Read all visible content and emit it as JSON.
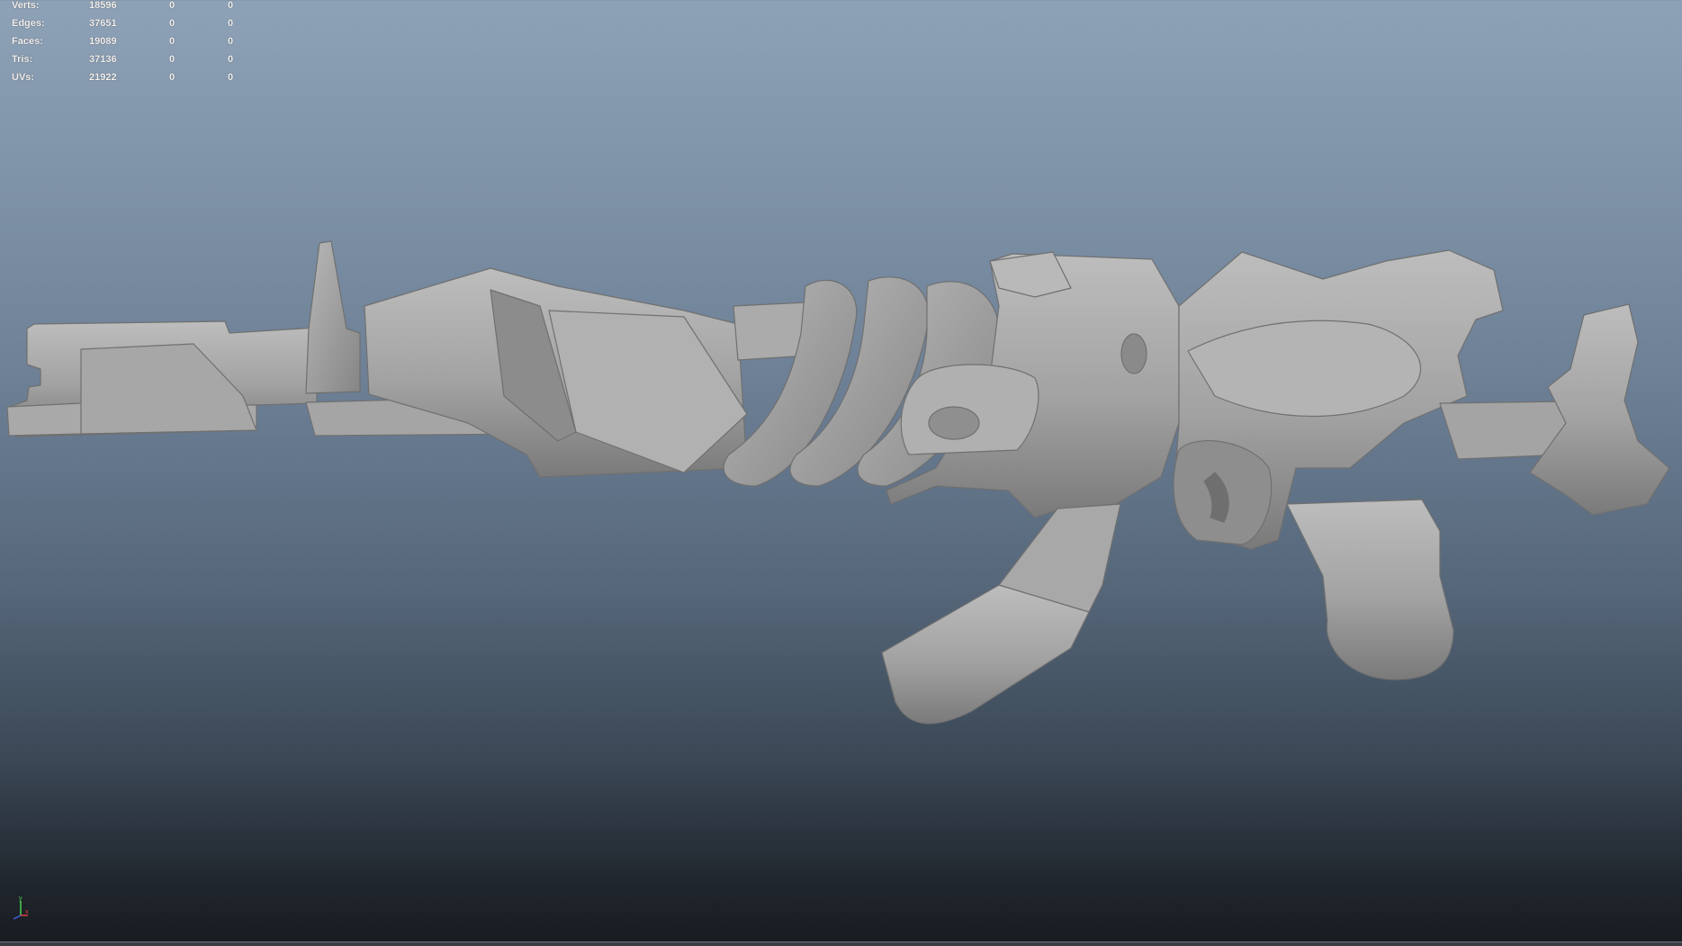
{
  "hud": {
    "rows": [
      {
        "label": "Verts:",
        "c1": "18596",
        "c2": "0",
        "c3": "0"
      },
      {
        "label": "Edges:",
        "c1": "37651",
        "c2": "0",
        "c3": "0"
      },
      {
        "label": "Faces:",
        "c1": "19089",
        "c2": "0",
        "c3": "0"
      },
      {
        "label": "Tris:",
        "c1": "37136",
        "c2": "0",
        "c3": "0"
      },
      {
        "label": "UVs:",
        "c1": "21922",
        "c2": "0",
        "c3": "0"
      }
    ]
  },
  "axis": {
    "y_label": "y",
    "x_label": "x",
    "y_color": "#4cd24c",
    "x_color": "#e04040",
    "z_color": "#4060e0"
  },
  "colors": {
    "model_fill": "#a3a3a3",
    "model_shadow": "#6e6e6e",
    "model_highlight": "#c4c4c4"
  }
}
